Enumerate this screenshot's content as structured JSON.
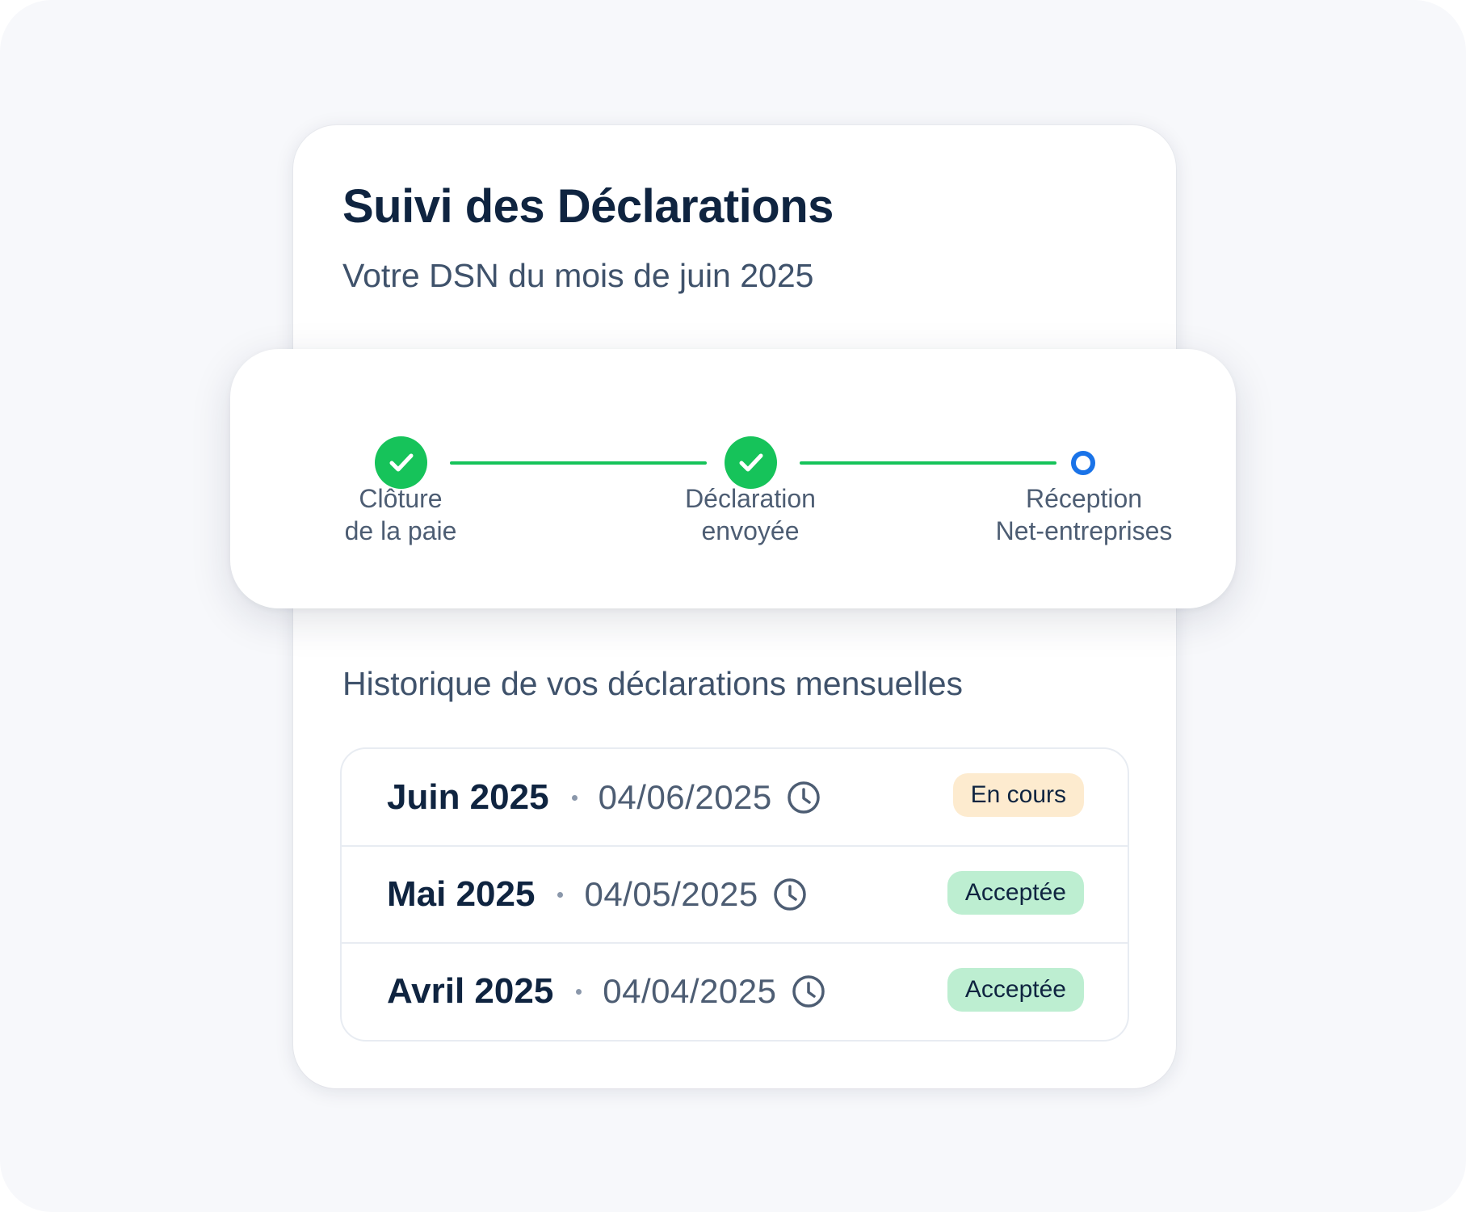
{
  "header": {
    "title": "Suivi des Déclarations",
    "subtitle": "Votre DSN du mois de juin 2025"
  },
  "stepper": {
    "steps": [
      {
        "line1": "Clôture",
        "line2": "de la paie",
        "status": "done",
        "icon": "check-icon"
      },
      {
        "line1": "Déclaration",
        "line2": "envoyée",
        "status": "done",
        "icon": "check-icon"
      },
      {
        "line1": "Réception",
        "line2": "Net-entreprises",
        "status": "current",
        "icon": "pending-dot-icon"
      }
    ],
    "colors": {
      "done": "#16c35a",
      "current": "#1a73e8"
    }
  },
  "history": {
    "title": "Historique de vos déclarations mensuelles",
    "rows": [
      {
        "month": "Juin 2025",
        "date": "04/06/2025",
        "status": "En cours",
        "status_type": "pending"
      },
      {
        "month": "Mai 2025",
        "date": "04/05/2025",
        "status": "Acceptée",
        "status_type": "accepted"
      },
      {
        "month": "Avril 2025",
        "date": "04/04/2025",
        "status": "Acceptée",
        "status_type": "accepted"
      }
    ],
    "status_colors": {
      "pending": "#fdebcf",
      "accepted": "#bdeed1"
    }
  }
}
